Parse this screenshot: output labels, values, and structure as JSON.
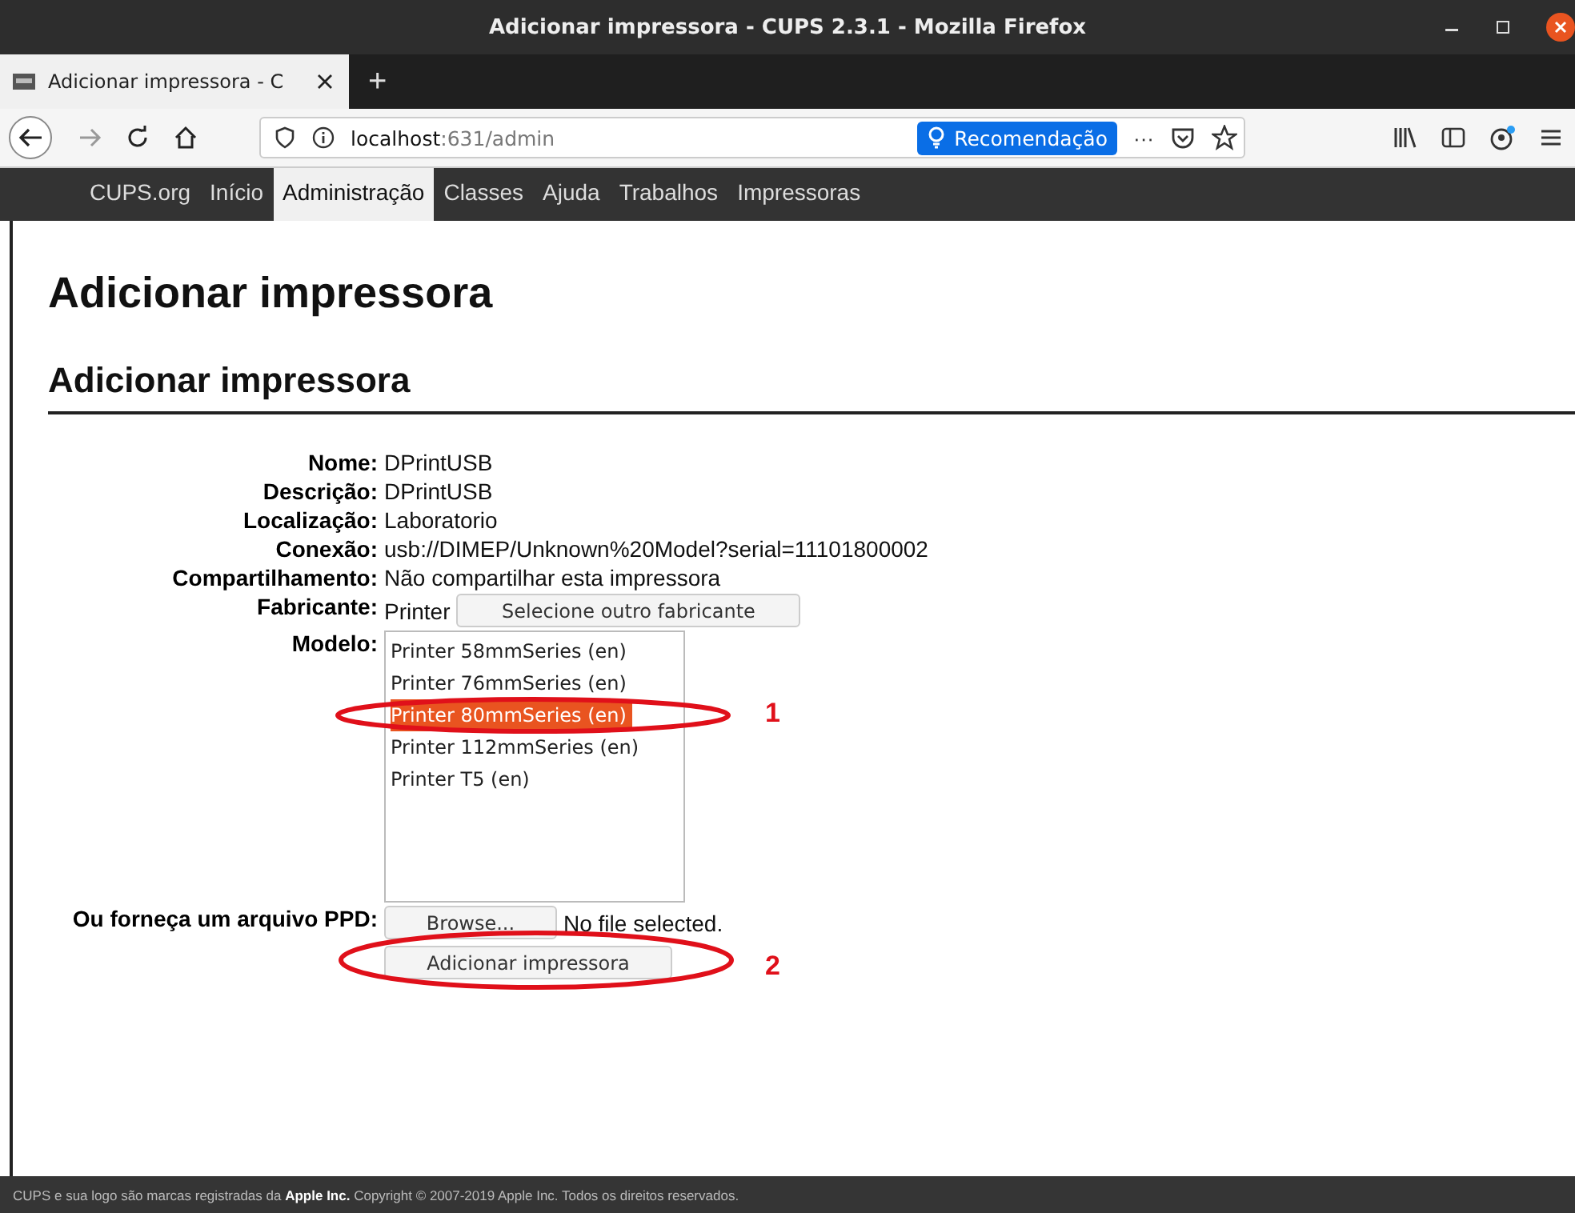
{
  "window": {
    "title": "Adicionar impressora - CUPS 2.3.1 - Mozilla Firefox"
  },
  "tab": {
    "title": "Adicionar impressora - C",
    "new_tab": "+"
  },
  "toolbar": {
    "url_host": "localhost",
    "url_rest": ":631/admin",
    "recommendation": "Recomendação",
    "more": "···"
  },
  "nav": [
    {
      "label": "CUPS.org",
      "selected": false
    },
    {
      "label": "Início",
      "selected": false
    },
    {
      "label": "Administração",
      "selected": true
    },
    {
      "label": "Classes",
      "selected": false
    },
    {
      "label": "Ajuda",
      "selected": false
    },
    {
      "label": "Trabalhos",
      "selected": false
    },
    {
      "label": "Impressoras",
      "selected": false
    }
  ],
  "heading": "Adicionar impressora",
  "subheading": "Adicionar impressora",
  "fields": [
    {
      "label": "Nome:",
      "value": "DPrintUSB"
    },
    {
      "label": "Descrição:",
      "value": "DPrintUSB"
    },
    {
      "label": "Localização:",
      "value": "Laboratorio"
    },
    {
      "label": "Conexão:",
      "value": "usb://DIMEP/Unknown%20Model?serial=11101800002"
    },
    {
      "label": "Compartilhamento:",
      "value": "Não compartilhar esta impressora"
    }
  ],
  "manufacturer": {
    "label": "Fabricante:",
    "value": "Printer",
    "button": "Selecione outro fabricante"
  },
  "model": {
    "label": "Modelo:",
    "options": [
      {
        "text": "Printer 58mmSeries (en)",
        "selected": false
      },
      {
        "text": "Printer 76mmSeries (en)",
        "selected": false
      },
      {
        "text": "Printer 80mmSeries (en)",
        "selected": true
      },
      {
        "text": "Printer 112mmSeries (en)",
        "selected": false
      },
      {
        "text": "Printer T5 (en)",
        "selected": false
      }
    ]
  },
  "ppd": {
    "label": "Ou forneça um arquivo PPD:",
    "browse": "Browse...",
    "status": "No file selected."
  },
  "submit": "Adicionar impressora",
  "annotations": [
    "1",
    "2"
  ],
  "footer": "CUPS e sua logo são marcas registradas da **Apple Inc.** Copyright © 2007-2019 Apple Inc. Todos os direitos reservados."
}
